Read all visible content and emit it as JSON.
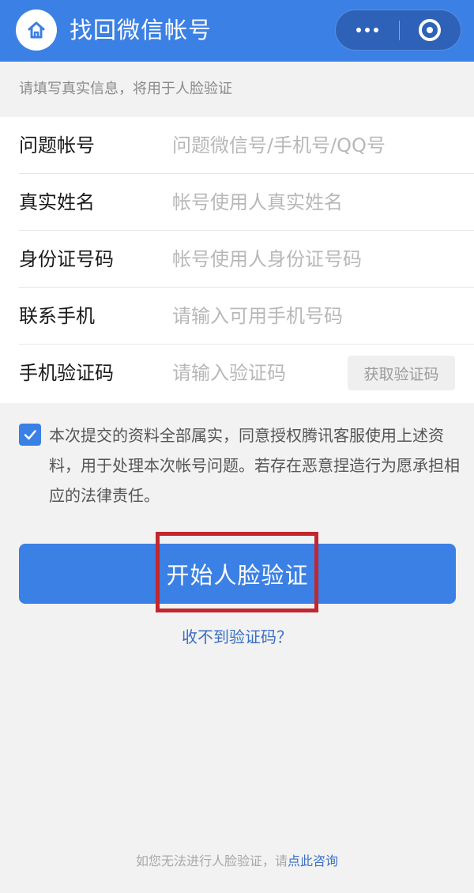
{
  "header": {
    "title": "找回微信帐号",
    "home_icon": "home-icon",
    "more_icon": "more-dots-icon",
    "close_icon": "miniprogram-close-icon",
    "bg_color": "#3b80e4"
  },
  "hint": "请填写真实信息，将用于人脸验证",
  "form": {
    "rows": [
      {
        "label": "问题帐号",
        "value": "",
        "placeholder": "问题微信号/手机号/QQ号"
      },
      {
        "label": "真实姓名",
        "value": "",
        "placeholder": "帐号使用人真实姓名"
      },
      {
        "label": "身份证号码",
        "value": "",
        "placeholder": "帐号使用人身份证号码"
      },
      {
        "label": "联系手机",
        "value": "",
        "placeholder": "请输入可用手机号码"
      },
      {
        "label": "手机验证码",
        "value": "",
        "placeholder": "请输入验证码"
      }
    ],
    "get_code_button": "获取验证码"
  },
  "agreement": {
    "checked": true,
    "text": "本次提交的资料全部属实，同意授权腾讯客服使用上述资料，用于处理本次帐号问题。若存在恶意捏造行为愿承担相应的法律责任。"
  },
  "primary_button": "开始人脸验证",
  "highlight_color": "#c1272d",
  "no_code_link": "收不到验证码？",
  "footer": {
    "prefix": "如您无法进行人脸验证，请",
    "link": "点此咨询"
  }
}
